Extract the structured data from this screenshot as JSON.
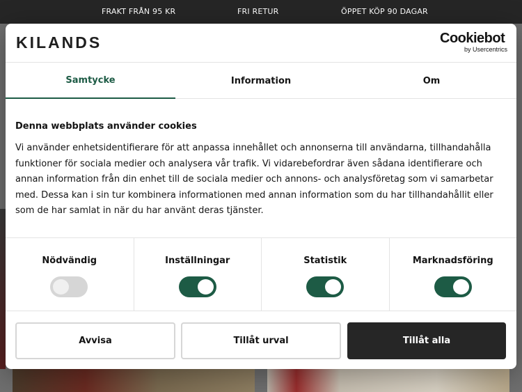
{
  "topbar": {
    "items": [
      "FRAKT FRÅN 95 KR",
      "FRI RETUR",
      "ÖPPET KÖP 90 DAGAR"
    ]
  },
  "dialog": {
    "brand": "KILANDS",
    "cookiebot": {
      "main": "Cookiebot",
      "sub": "by Usercentrics"
    },
    "tabs": [
      {
        "label": "Samtycke",
        "active": true
      },
      {
        "label": "Information",
        "active": false
      },
      {
        "label": "Om",
        "active": false
      }
    ],
    "title": "Denna webbplats använder cookies",
    "text": "Vi använder enhetsidentifierare för att anpassa innehållet och annonserna till användarna, tillhandahålla funktioner för sociala medier och analysera vår trafik. Vi vidarebefordrar även sådana identifierare och annan information från din enhet till de sociala medier och annons- och analysföretag som vi samarbetar med. Dessa kan i sin tur kombinera informationen med annan information som du har tillhandahållit eller som de har samlat in när du har använt deras tjänster.",
    "categories": [
      {
        "label": "Nödvändig",
        "checked": true,
        "disabled": true
      },
      {
        "label": "Inställningar",
        "checked": true,
        "disabled": false
      },
      {
        "label": "Statistik",
        "checked": true,
        "disabled": false
      },
      {
        "label": "Marknadsföring",
        "checked": true,
        "disabled": false
      }
    ],
    "buttons": {
      "reject": "Avvisa",
      "allow_selection": "Tillåt urval",
      "allow_all": "Tillåt alla"
    }
  },
  "colors": {
    "accent": "#1d5b45",
    "dark": "#262626",
    "toggle_disabled": "#d6d6d6"
  }
}
